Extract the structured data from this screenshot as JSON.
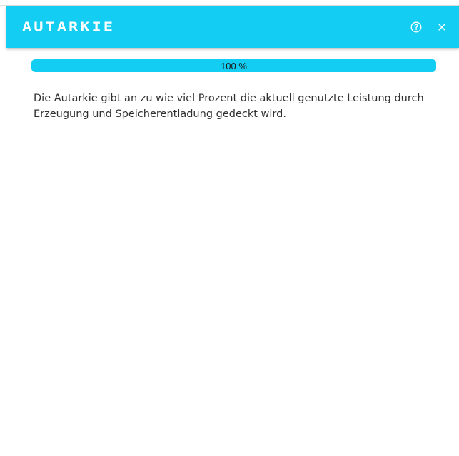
{
  "dialog": {
    "title": "AUTARKIE",
    "help_icon": "help-circle-icon",
    "close_icon": "close-icon"
  },
  "progress": {
    "value": 100,
    "label": "100 %"
  },
  "description": "Die Autarkie gibt an zu wie viel Prozent die aktuell genutzte Leistung durch Erzeugung und Speicherentladung gedeckt wird.",
  "colors": {
    "accent": "#13cdf3",
    "header_text": "#ffffff",
    "body_text": "#303030"
  }
}
